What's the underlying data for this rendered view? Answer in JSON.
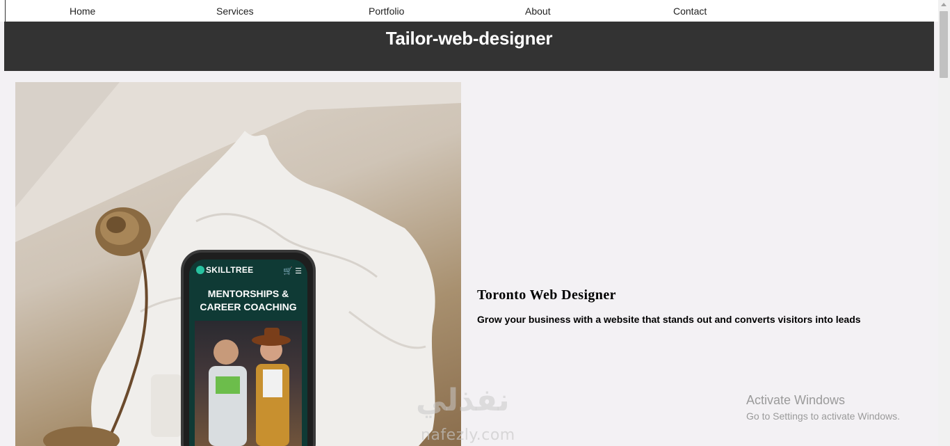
{
  "nav": {
    "items": [
      "Home",
      "Services",
      "Portfolio",
      "About",
      "Contact"
    ]
  },
  "header": {
    "title": "Tailor-web-designer"
  },
  "hero": {
    "phone": {
      "brand": "SKILLTREE",
      "icons": "🛒 ☰",
      "heading_line1": "MENTORSHIPS &",
      "heading_line2": "CAREER COACHING"
    }
  },
  "content": {
    "title": "Toronto Web Designer",
    "subtitle": "Grow your business with a website that stands out and converts visitors into leads"
  },
  "watermark": {
    "arabic": "نفذلي",
    "latin": "nafezly.com"
  },
  "system_notice": {
    "title": "Activate Windows",
    "subtitle": "Go to Settings to activate Windows."
  },
  "colors": {
    "header_bg": "#333333",
    "page_bg": "#f3f1f4",
    "nav_bg": "#ffffff"
  }
}
